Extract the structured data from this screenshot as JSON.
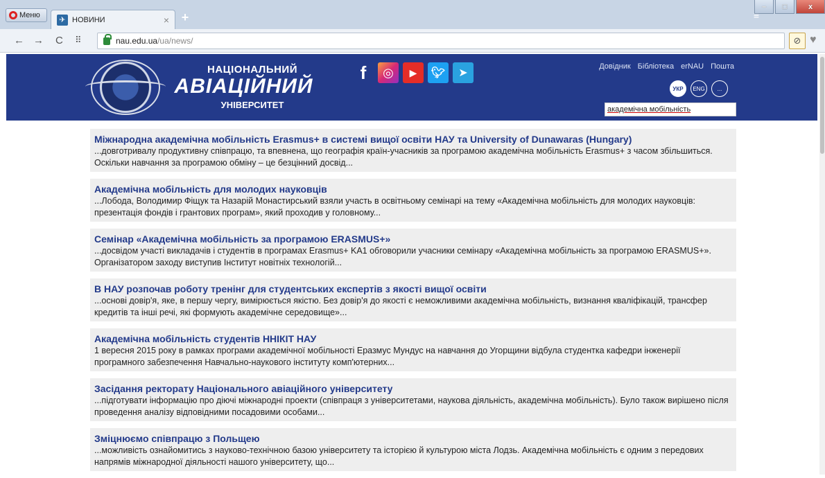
{
  "browser": {
    "menu_label": "Меню",
    "tab_title": "НОВИНИ",
    "new_tab_symbol": "+",
    "url_host": "nau.edu.ua",
    "url_path": "/ua/news/"
  },
  "header": {
    "logo_line1": "НАЦІОНАЛЬНИЙ",
    "logo_line2": "АВІАЦІЙНИЙ",
    "logo_line3": "УНІВЕРСИТЕТ",
    "top_links": [
      "Довідник",
      "Бібліотека",
      "erNAU",
      "Пошта"
    ],
    "languages": [
      "УКР",
      "ENG",
      "..."
    ],
    "search_value": "академічна мобільність"
  },
  "results": [
    {
      "title": "Міжнародна академічна мобільність Erasmus+ в системі вищої освіти НАУ та University of Dunawaras (Hungary)",
      "snippet": "...довготривалу продуктивну співпрацю, та впевнена, що географія країн-учасників за програмою академічна мобільність Erasmus+ з часом збільшиться. Оскільки навчання за програмою обміну – це безцінний досвід..."
    },
    {
      "title": "Академічна мобільність для молодих науковців",
      "snippet": "...Лобода, Володимир Фіщук та Назарій Монастирський взяли участь в освітньому семінарі на тему «Академічна мобільність для молодих науковців: презентація фондів і грантових програм», який проходив у головному..."
    },
    {
      "title": "Семінар «Академічна мобільність за програмою ERASMUS+»",
      "snippet": "...досвідом участі викладачів і студентів в програмах Erasmus+ KA1 обговорили учасники семінару «Академічна мобільність за програмою ERASMUS+». Організатором заходу виступив Інститут новітніх технологій..."
    },
    {
      "title": "В НАУ розпочав роботу тренінг для студентських експертів з якості вищої освіти",
      "snippet": "...основі довір'я, яке, в першу чергу, вимірюється якістю. Без довір'я до якості є неможливими академічна мобільність, визнання кваліфікацій, трансфер кредитів та інші речі, які формують академічне середовище»..."
    },
    {
      "title": "Академічна мобільність студентів ННІКІТ НАУ",
      "snippet": "1 вересня 2015 року в рамках програми академічної мобільності Еразмус Мундус на навчання до Угорщини відбула студентка кафедри інженерії програмного забезпечення Навчально-наукового інституту комп'ютерних..."
    },
    {
      "title": "Засідання ректорату Національного авіаційного університету",
      "snippet": "...підготувати інформацію про діючі міжнародні проекти (співпраця з університетами, наукова діяльність, академічна мобільність). Було також вирішено після проведення аналізу відповідними посадовими особами..."
    },
    {
      "title": "Зміцнюємо співпрацю з Польщею",
      "snippet": "...можливість ознайомитись з науково-технічною базою університету та історією й культурою міста Лодзь. Академічна мобільність є одним з передових напрямів міжнародної діяльності нашого університету, що..."
    }
  ]
}
